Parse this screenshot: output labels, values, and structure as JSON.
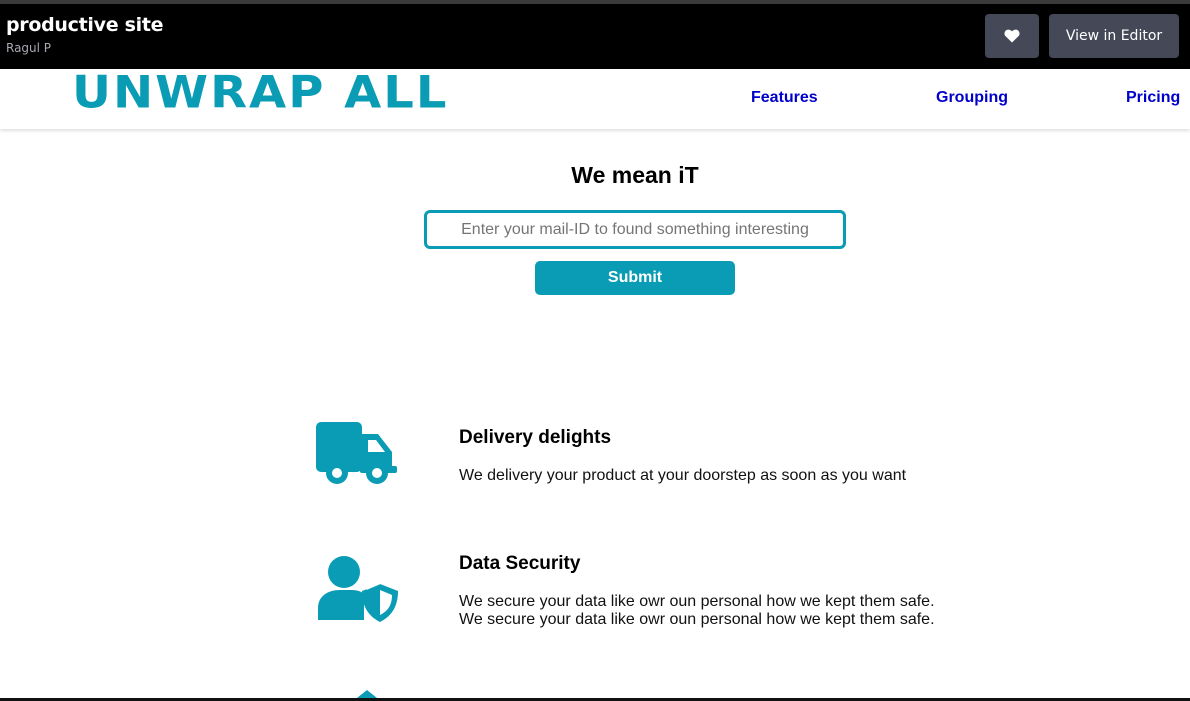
{
  "pen": {
    "title": "productive site",
    "author": "Ragul P",
    "view_editor_label": "View in Editor",
    "heart_icon": "heart-icon"
  },
  "site": {
    "logo": "UNWRAP ALL",
    "nav": [
      "Features",
      "Grouping",
      "Pricing"
    ]
  },
  "hero": {
    "title": "We mean iT",
    "email_placeholder": "Enter your mail-ID to found something interesting",
    "submit_label": "Submit"
  },
  "features": [
    {
      "icon": "truck-icon",
      "title": "Delivery delights",
      "lines": [
        "We delivery your product at your doorstep as soon as you want"
      ]
    },
    {
      "icon": "user-shield-icon",
      "title": "Data Security",
      "lines": [
        "We secure your data like owr oun personal how we kept them safe.",
        "We secure your data like owr oun personal how we kept them safe."
      ]
    }
  ],
  "colors": {
    "accent": "#0a9cb4",
    "nav_link": "#0000cd",
    "topbar_bg": "#000000",
    "topbar_button": "#444857"
  }
}
